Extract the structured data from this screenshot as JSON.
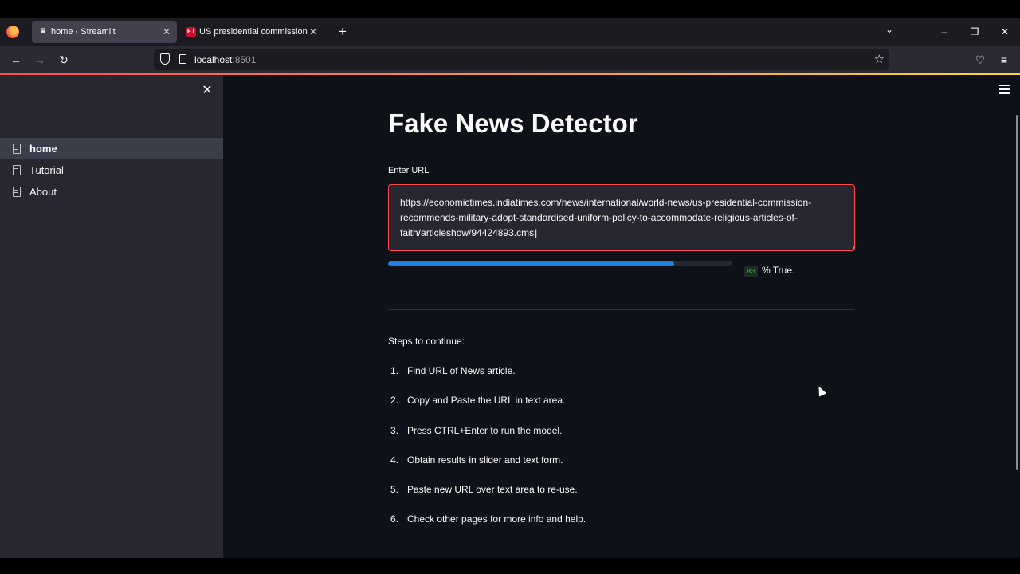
{
  "browser": {
    "tabs": [
      {
        "label": "home · Streamlit",
        "active": true,
        "icon": "streamlit-crown-icon"
      },
      {
        "label": "US presidential commission rec",
        "active": false,
        "icon": "et-favicon",
        "icon_text": "ET"
      }
    ],
    "new_tab_label": "+",
    "url_host": "localhost",
    "url_port": ":8501"
  },
  "sidebar": {
    "items": [
      {
        "label": "home",
        "active": true
      },
      {
        "label": "Tutorial",
        "active": false
      },
      {
        "label": "About",
        "active": false
      }
    ]
  },
  "main": {
    "title": "Fake News Detector",
    "input_label": "Enter URL",
    "input_value": "https://economictimes.indiatimes.com/news/international/world-news/us-presidential-commission-recommends-military-adopt-standardised-uniform-policy-to-accommodate-religious-articles-of-faith/articleshow/94424893.cms",
    "progress_value": 0.83,
    "score_badge": "83",
    "score_text": "% True.",
    "steps_heading": "Steps to continue:",
    "steps": [
      {
        "num": "1.",
        "text": "Find URL of News article."
      },
      {
        "num": "2.",
        "text": "Copy and Paste the URL in text area."
      },
      {
        "num": "3.",
        "text": "Press CTRL+Enter to run the model."
      },
      {
        "num": "4.",
        "text": "Obtain results in slider and text form."
      },
      {
        "num": "5.",
        "text": "Paste new URL over text area to re-use."
      },
      {
        "num": "6.",
        "text": "Check other pages for more info and help."
      }
    ]
  },
  "colors": {
    "accent": "#ff4b4b",
    "progress": "#1c83e1",
    "main_bg": "#0e1117",
    "sidebar_bg": "#262730"
  }
}
